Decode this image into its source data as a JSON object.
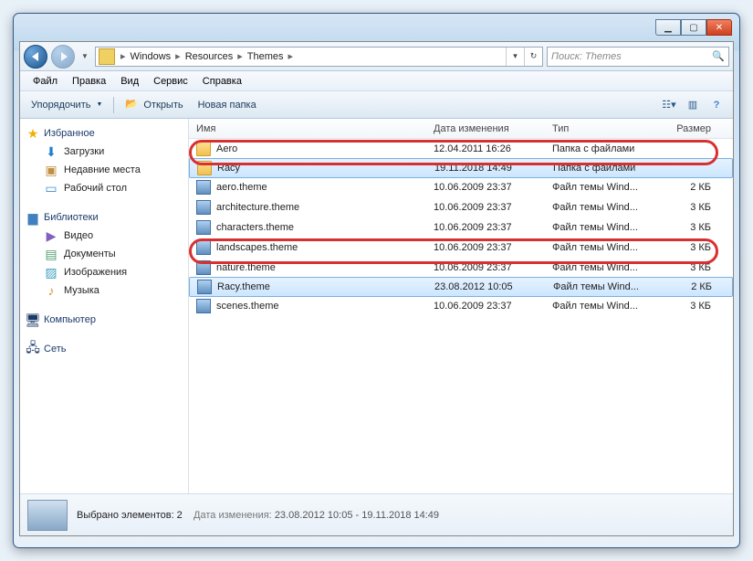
{
  "window": {
    "min_tip": "Свернуть",
    "max_tip": "Развернуть",
    "close_tip": "Закрыть"
  },
  "address": {
    "crumbs": [
      "Windows",
      "Resources",
      "Themes"
    ],
    "sep": "▸",
    "refresh": "↻"
  },
  "search": {
    "placeholder": "Поиск: Themes"
  },
  "menu": {
    "file": "Файл",
    "edit": "Правка",
    "view": "Вид",
    "tools": "Сервис",
    "help": "Справка"
  },
  "toolbar": {
    "organize": "Упорядочить",
    "open": "Открыть",
    "newfolder": "Новая папка"
  },
  "sidebar": {
    "favorites": {
      "title": "Избранное",
      "items": [
        "Загрузки",
        "Недавние места",
        "Рабочий стол"
      ]
    },
    "libraries": {
      "title": "Библиотеки",
      "items": [
        "Видео",
        "Документы",
        "Изображения",
        "Музыка"
      ]
    },
    "computer": {
      "title": "Компьютер"
    },
    "network": {
      "title": "Сеть"
    }
  },
  "columns": {
    "name": "Имя",
    "date": "Дата изменения",
    "type": "Тип",
    "size": "Размер"
  },
  "types": {
    "folder": "Папка с файлами",
    "theme": "Файл темы Wind..."
  },
  "files": [
    {
      "icon": "folder",
      "name": "Aero",
      "date": "12.04.2011 16:26",
      "typeKey": "folder",
      "size": "",
      "sel": false
    },
    {
      "icon": "folder",
      "name": "Racy",
      "date": "19.11.2018 14:49",
      "typeKey": "folder",
      "size": "",
      "sel": true
    },
    {
      "icon": "theme",
      "name": "aero.theme",
      "date": "10.06.2009 23:37",
      "typeKey": "theme",
      "size": "2 КБ",
      "sel": false
    },
    {
      "icon": "theme",
      "name": "architecture.theme",
      "date": "10.06.2009 23:37",
      "typeKey": "theme",
      "size": "3 КБ",
      "sel": false
    },
    {
      "icon": "theme",
      "name": "characters.theme",
      "date": "10.06.2009 23:37",
      "typeKey": "theme",
      "size": "3 КБ",
      "sel": false
    },
    {
      "icon": "theme",
      "name": "landscapes.theme",
      "date": "10.06.2009 23:37",
      "typeKey": "theme",
      "size": "3 КБ",
      "sel": false
    },
    {
      "icon": "theme",
      "name": "nature.theme",
      "date": "10.06.2009 23:37",
      "typeKey": "theme",
      "size": "3 КБ",
      "sel": false
    },
    {
      "icon": "theme",
      "name": "Racy.theme",
      "date": "23.08.2012 10:05",
      "typeKey": "theme",
      "size": "2 КБ",
      "sel": true
    },
    {
      "icon": "theme",
      "name": "scenes.theme",
      "date": "10.06.2009 23:37",
      "typeKey": "theme",
      "size": "3 КБ",
      "sel": false
    }
  ],
  "status": {
    "selected": "Выбрано элементов: 2",
    "date_label": "Дата изменения:",
    "date_value": "23.08.2012 10:05 - 19.11.2018 14:49"
  },
  "icons": {
    "star": "★",
    "download": "⬇",
    "recent": "▣",
    "desktop": "▭",
    "lib": "▆",
    "video": "▶",
    "doc": "▤",
    "image": "▨",
    "music": "♪",
    "computer": "🖥",
    "network": "🖧",
    "search": "🔍",
    "open_folder": "📂",
    "views": "☷",
    "preview": "▥",
    "help": "?"
  }
}
